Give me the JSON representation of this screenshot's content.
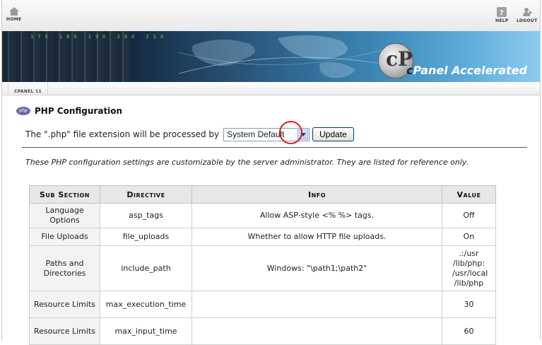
{
  "topnav": {
    "home_label": "HOME",
    "help_label": "HELP",
    "logout_label": "LOGOUT"
  },
  "banner": {
    "logo_mark": "cP",
    "logo_text_c": "c",
    "logo_text_rest": "Panel Accelerated",
    "numbers": "17X 18X 19X 20X 21X"
  },
  "breadcrumb": {
    "tab_label": "CPANEL 11"
  },
  "page": {
    "icon_text": "php",
    "title": "PHP Configuration",
    "extension_label": "The \".php\" file extension will be processed by",
    "select_value": "System Default",
    "update_button": "Update",
    "note": "These PHP configuration settings are customizable by the server administrator. They are listed for reference only."
  },
  "table": {
    "headers": [
      "Sub Section",
      "Directive",
      "Info",
      "Value"
    ],
    "rows": [
      {
        "sub": "Language Options",
        "directive": "asp_tags",
        "info": "Allow ASP-style <% %> tags.",
        "value": "Off"
      },
      {
        "sub": "File Uploads",
        "directive": "file_uploads",
        "info": "Whether to allow HTTP file uploads.",
        "value": "On"
      },
      {
        "sub": "Paths and Directories",
        "directive": "include_path",
        "info": "Windows: \"\\path1;\\path2\"",
        "value": ".:/usr /lib/php: /usr/local /lib/php"
      },
      {
        "sub": "Resource Limits",
        "directive": "max_execution_time",
        "info": "",
        "value": "30"
      },
      {
        "sub": "Resource Limits",
        "directive": "max_input_time",
        "info": "",
        "value": "60"
      }
    ]
  }
}
